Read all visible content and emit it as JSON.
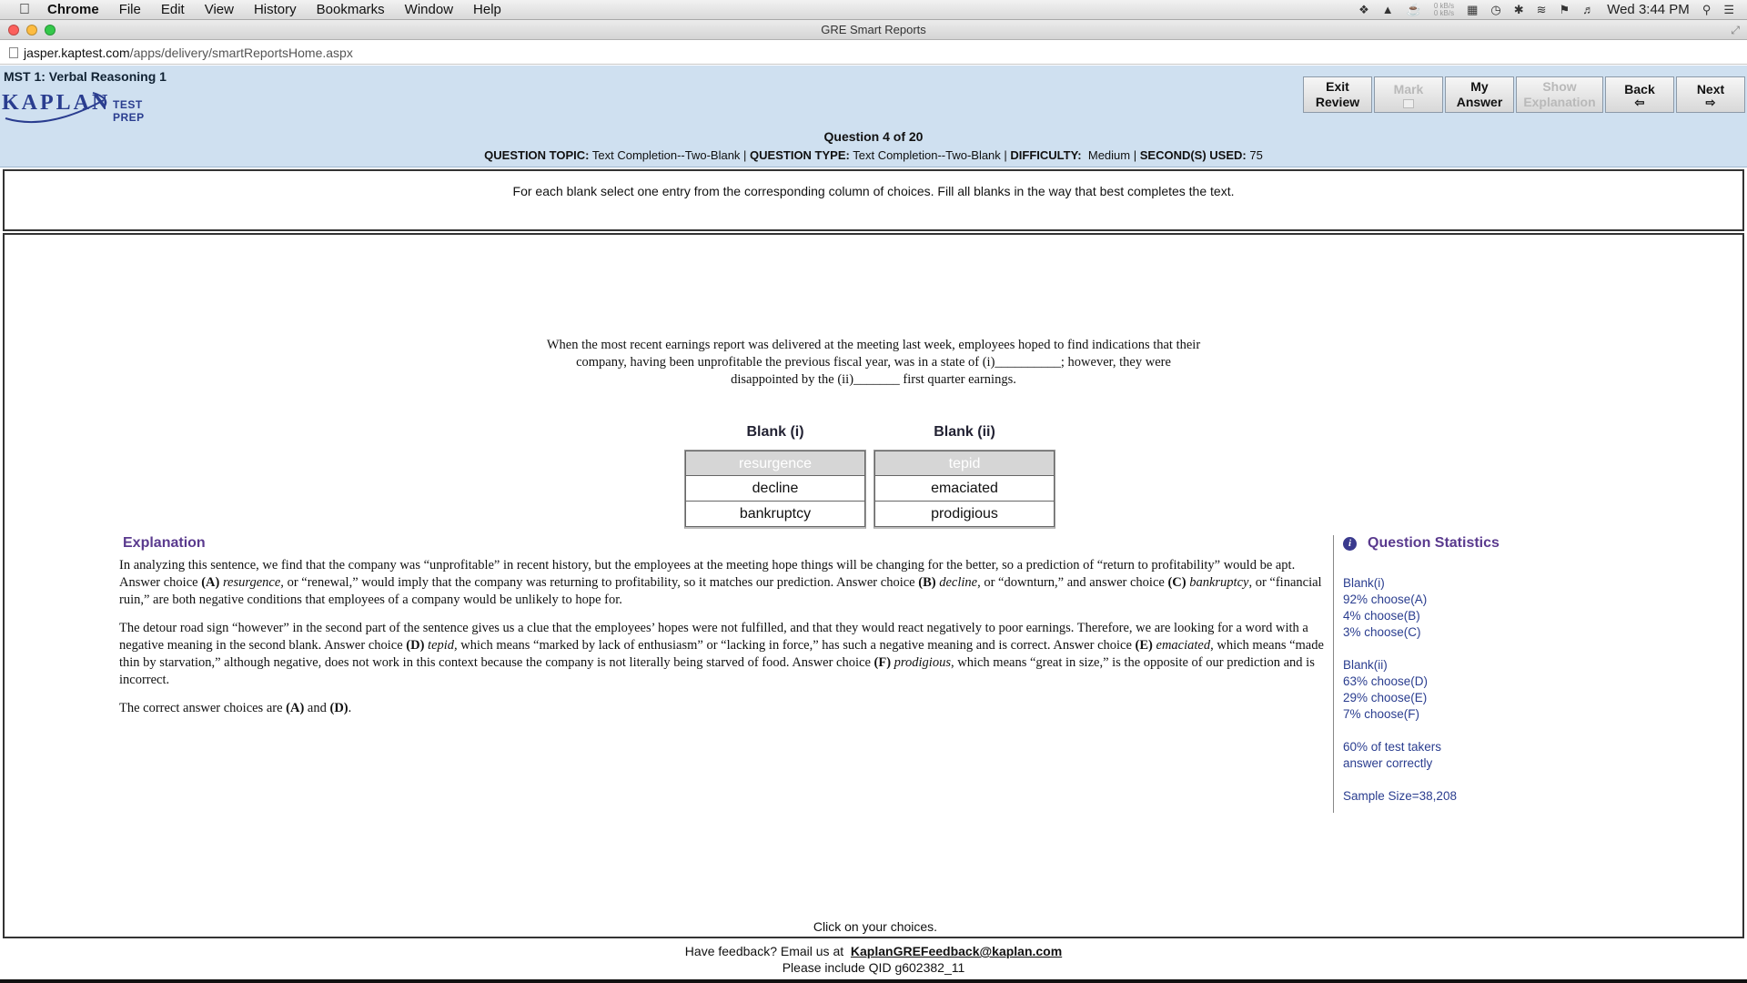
{
  "menubar": {
    "app": "Chrome",
    "items": [
      "File",
      "Edit",
      "View",
      "History",
      "Bookmarks",
      "Window",
      "Help"
    ],
    "clock": "Wed 3:44 PM",
    "net_rate_up": "0 kB/s",
    "net_rate_down": "0 kB/s"
  },
  "window": {
    "title": "GRE Smart Reports"
  },
  "address": {
    "host": "jasper.kaptest.com",
    "path": "/apps/delivery/smartReportsHome.aspx"
  },
  "header": {
    "test_name": "MST 1:  Verbal Reasoning 1",
    "logo_word": "KAPLAN",
    "logo_sub": "TEST PREP",
    "buttons": {
      "exit_review": [
        "Exit",
        "Review"
      ],
      "mark": "Mark",
      "my_answer": [
        "My",
        "Answer"
      ],
      "show_explanation": [
        "Show",
        "Explanation"
      ],
      "back": "Back",
      "next": "Next"
    },
    "question_number": "Question 4 of 20",
    "meta": {
      "topic_label": "QUESTION TOPIC:",
      "topic": "Text Completion--Two-Blank",
      "type_label": "QUESTION TYPE:",
      "type": "Text Completion--Two-Blank",
      "difficulty_label": "DIFFICULTY:",
      "difficulty": "Medium",
      "seconds_label": "SECOND(S) USED:",
      "seconds": "75"
    }
  },
  "instructions": "For each blank select one entry from the corresponding column of choices. Fill all blanks in the way that best completes the text.",
  "passage": {
    "line1": "When the most recent earnings report was delivered at the meeting last week, employees hoped to find indications that their",
    "line2": "company, having been unprofitable the previous fiscal year, was in a state of (i)__________; however, they were",
    "line3": "disappointed by the (ii)_______ first quarter earnings."
  },
  "blanks": {
    "blank1": {
      "heading": "Blank (i)",
      "choices": [
        "resurgence",
        "decline",
        "bankruptcy"
      ],
      "selected_index": 0
    },
    "blank2": {
      "heading": "Blank (ii)",
      "choices": [
        "tepid",
        "emaciated",
        "prodigious"
      ],
      "selected_index": 0
    }
  },
  "explanation": {
    "title": "Explanation",
    "p1": {
      "a": "In analyzing this sentence, we find that the company was “unprofitable” in recent history, but the employees at the meeting hope things will be changing for the better, so a prediction of “return to profitability” would be apt. Answer choice ",
      "b": "(A)",
      "c": "resurgence,",
      "d": " or “renewal,” would imply that the company was returning to profitability, so it matches our prediction. Answer choice ",
      "e": "(B)",
      "f": "decline",
      "g": ", or “downturn,” and answer choice ",
      "h": "(C)",
      "i": "bankruptcy",
      "j": ", or “financial ruin,” are both negative conditions that employees of a company would be unlikely to hope for."
    },
    "p2": {
      "a": "The detour road sign “however” in the second part of the sentence gives us a clue that the employees’ hopes were not fulfilled, and that they would react negatively to poor earnings. Therefore, we are looking for a word with a negative meaning in the second blank. Answer choice ",
      "b": "(D)",
      "c": "tepid,",
      "d": " which means “marked by lack of enthusiasm” or “lacking in force,” has such a negative meaning and is correct. Answer choice ",
      "e": "(E)",
      "f": "emaciated",
      "g": ", which means “made thin by starvation,” although negative, does not work in this context because the company is not literally being starved of food. Answer choice ",
      "h": "(F)",
      "i": "prodigious",
      "j": ", which means “great in size,” is the opposite of our prediction and is incorrect."
    },
    "p3": {
      "a": "The correct answer choices are ",
      "b": "(A)",
      "c": " and ",
      "d": "(D)",
      "e": "."
    }
  },
  "stats": {
    "title": "Question Statistics",
    "blank1_label": "Blank(i)",
    "blank1_lines": [
      "92% choose(A)",
      "4% choose(B)",
      "3% choose(C)"
    ],
    "blank2_label": "Blank(ii)",
    "blank2_lines": [
      "63% choose(D)",
      "29% choose(E)",
      "7% choose(F)"
    ],
    "correct_line1": "60% of test takers",
    "correct_line2": "answer correctly",
    "sample": "Sample Size=38,208"
  },
  "click_note": "Click on your choices.",
  "footer": {
    "prefix": "Have feedback? Email us at ",
    "email": "KaplanGREFeedback@kaplan.com",
    "qid": "Please include QID g602382_11"
  },
  "colors": {
    "header_bg": "#cfe0f0",
    "accent_purple": "#5a3a8e",
    "stats_blue": "#2a3d8f"
  }
}
